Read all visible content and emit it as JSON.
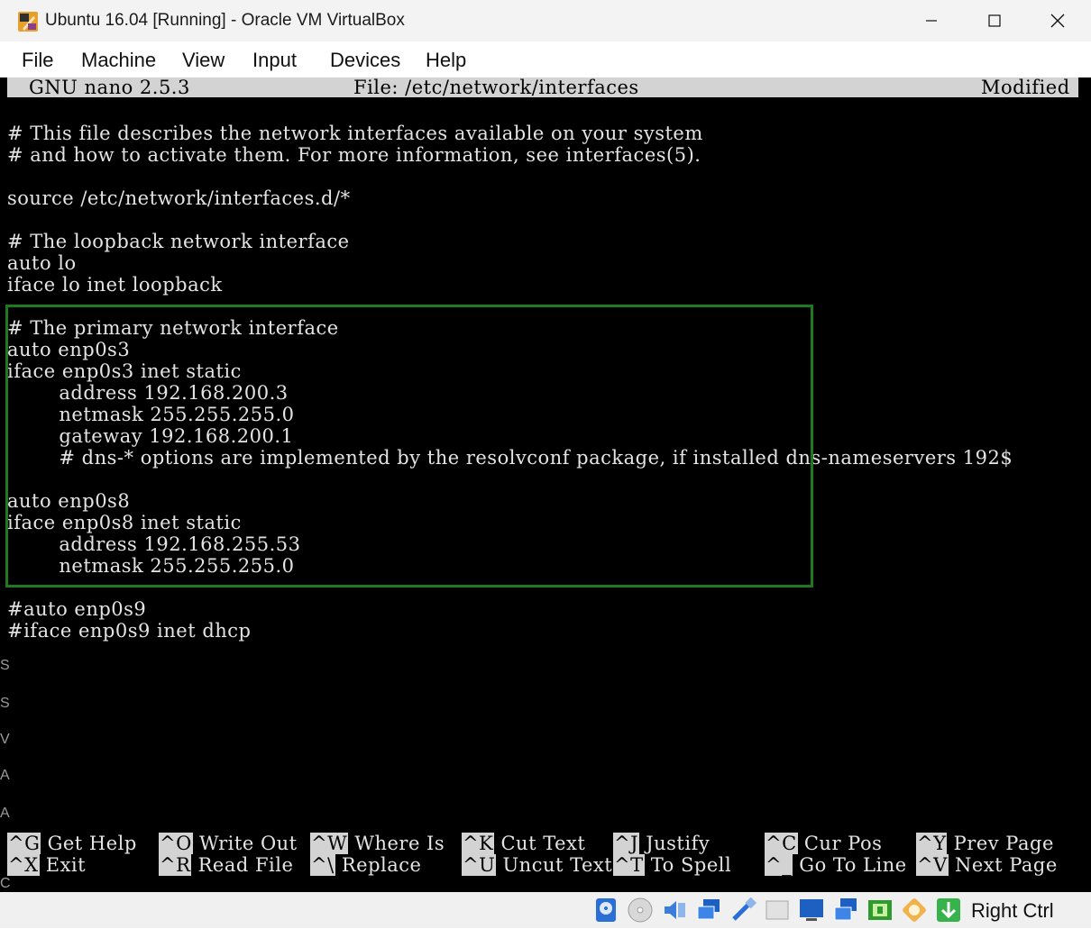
{
  "window": {
    "title": "Ubuntu 16.04 [Running] - Oracle VM VirtualBox"
  },
  "menu": [
    "File",
    "Machine",
    "View",
    "Input",
    "Devices",
    "Help"
  ],
  "nano": {
    "version": "GNU nano 2.5.3",
    "file": "File: /etc/network/interfaces",
    "status": "Modified"
  },
  "file_lines": [
    "",
    "# This file describes the network interfaces available on your system",
    "# and how to activate them. For more information, see interfaces(5).",
    "",
    "source /etc/network/interfaces.d/*",
    "",
    "# The loopback network interface",
    "auto lo",
    "iface lo inet loopback",
    "",
    "# The primary network interface",
    "auto enp0s3",
    "iface enp0s3 inet static",
    "        address 192.168.200.3",
    "        netmask 255.255.255.0",
    "        gateway 192.168.200.1",
    "        # dns-* options are implemented by the resolvconf package, if installed dns-nameservers 192$",
    "",
    "auto enp0s8",
    "iface enp0s8 inet static",
    "        address 192.168.255.53",
    "        netmask 255.255.255.0",
    "",
    "#auto enp0s9",
    "#iface enp0s9 inet dhcp"
  ],
  "shortcuts": [
    {
      "key": "^G",
      "label": "Get Help"
    },
    {
      "key": "^O",
      "label": "Write Out"
    },
    {
      "key": "^W",
      "label": "Where Is"
    },
    {
      "key": "^K",
      "label": "Cut Text"
    },
    {
      "key": "^J",
      "label": "Justify"
    },
    {
      "key": "^C",
      "label": "Cur Pos"
    },
    {
      "key": "^Y",
      "label": "Prev Page"
    },
    {
      "key": "^X",
      "label": "Exit"
    },
    {
      "key": "^R",
      "label": "Read File"
    },
    {
      "key": "^\\",
      "label": "Replace"
    },
    {
      "key": "^U",
      "label": "Uncut Text"
    },
    {
      "key": "^T",
      "label": "To Spell"
    },
    {
      "key": "^_",
      "label": "Go To Line"
    },
    {
      "key": "^V",
      "label": "Next Page"
    }
  ],
  "side_glyphs": [
    "S",
    "S",
    "V",
    "A",
    "A",
    "C"
  ],
  "statusbar": {
    "host_key": "Right Ctrl",
    "icons": [
      "hard-disk-icon",
      "optical-drive-icon",
      "audio-icon",
      "network-icon",
      "usb-icon",
      "shared-folders-icon",
      "display-icon",
      "video-capture-icon",
      "recording-icon",
      "cpu-icon",
      "mouse-integration-icon",
      "host-key-arrow-icon"
    ]
  },
  "colors": {
    "highlight_box": "#1f7a1f",
    "screen_bg": "#000000",
    "text": "#e4e4e4",
    "bar_bg": "#d3d3d3"
  }
}
